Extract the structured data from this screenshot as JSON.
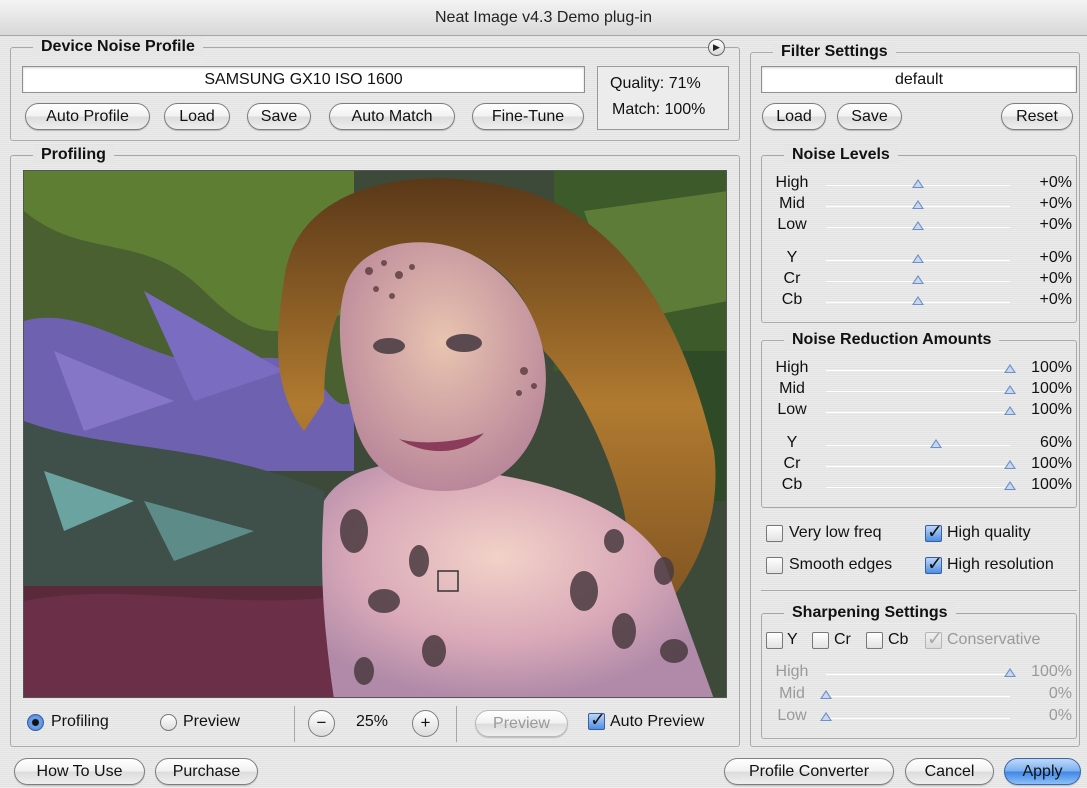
{
  "window": {
    "title": "Neat Image v4.3 Demo plug-in"
  },
  "device_noise_profile": {
    "title": "Device Noise Profile",
    "profile_name": "SAMSUNG GX10 ISO 1600",
    "quality": "Quality: 71%",
    "match": "Match: 100%",
    "buttons": {
      "auto_profile": "Auto Profile",
      "load": "Load",
      "save": "Save",
      "auto_match": "Auto Match",
      "fine_tune": "Fine-Tune"
    },
    "menu_icon": "play-circle-icon"
  },
  "profiling": {
    "title": "Profiling",
    "mode_profiling": "Profiling",
    "mode_preview": "Preview",
    "selected_mode": "Profiling",
    "zoom_out": "−",
    "zoom": "25%",
    "zoom_in": "+",
    "preview_button": "Preview",
    "auto_preview": "Auto Preview",
    "auto_preview_checked": true
  },
  "filter_settings": {
    "title": "Filter Settings",
    "preset": "default",
    "buttons": {
      "load": "Load",
      "save": "Save",
      "reset": "Reset"
    },
    "noise_levels": {
      "title": "Noise Levels",
      "rows": [
        {
          "name": "High",
          "value": "+0%",
          "level": 0.5
        },
        {
          "name": "Mid",
          "value": "+0%",
          "level": 0.5
        },
        {
          "name": "Low",
          "value": "+0%",
          "level": 0.5
        },
        {
          "name": "Y",
          "value": "+0%",
          "level": 0.5
        },
        {
          "name": "Cr",
          "value": "+0%",
          "level": 0.5
        },
        {
          "name": "Cb",
          "value": "+0%",
          "level": 0.5
        }
      ]
    },
    "noise_reduction": {
      "title": "Noise Reduction Amounts",
      "rows": [
        {
          "name": "High",
          "value": "100%",
          "level": 1.0
        },
        {
          "name": "Mid",
          "value": "100%",
          "level": 1.0
        },
        {
          "name": "Low",
          "value": "100%",
          "level": 1.0
        },
        {
          "name": "Y",
          "value": "60%",
          "level": 0.6
        },
        {
          "name": "Cr",
          "value": "100%",
          "level": 1.0
        },
        {
          "name": "Cb",
          "value": "100%",
          "level": 1.0
        }
      ]
    },
    "options": {
      "very_low_freq": {
        "label": "Very low freq",
        "checked": false
      },
      "high_quality": {
        "label": "High quality",
        "checked": true
      },
      "smooth_edges": {
        "label": "Smooth edges",
        "checked": false
      },
      "high_resolution": {
        "label": "High resolution",
        "checked": true
      }
    },
    "sharpening": {
      "title": "Sharpening Settings",
      "y": "Y",
      "cr": "Cr",
      "cb": "Cb",
      "conservative": "Conservative",
      "rows": [
        {
          "name": "High",
          "value": "100%",
          "level": 1.0
        },
        {
          "name": "Mid",
          "value": "0%",
          "level": 0.0
        },
        {
          "name": "Low",
          "value": "0%",
          "level": 0.0
        }
      ]
    }
  },
  "bottom_bar": {
    "how_to_use": "How To Use",
    "purchase": "Purchase",
    "profile_converter": "Profile Converter",
    "cancel": "Cancel",
    "apply": "Apply"
  },
  "colors": {
    "accent": "#3f86e6",
    "slider_thumb": "#6d8fc4"
  }
}
